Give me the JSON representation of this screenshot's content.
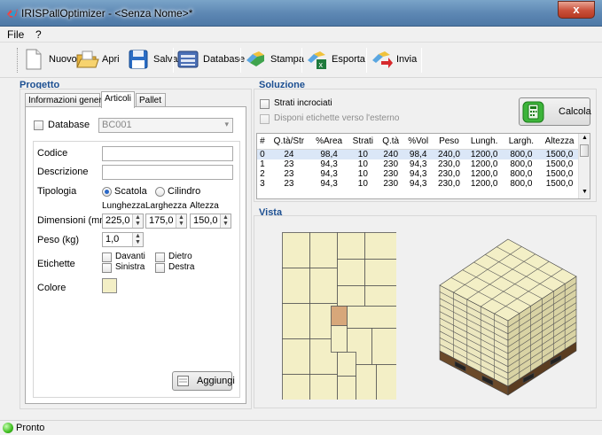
{
  "window": {
    "title": "IRISPallOptimizer - <Senza Nome>*",
    "close_label": "x"
  },
  "menu": {
    "file": "File",
    "help": "?"
  },
  "toolbar": {
    "nuovo": "Nuovo",
    "apri": "Apri",
    "salva": "Salva",
    "database": "Database",
    "stampa": "Stampa",
    "esporta": "Esporta",
    "invia": "Invia"
  },
  "progetto": {
    "title": "Progetto",
    "tabs": [
      "Informazioni generali",
      "Articoli",
      "Pallet"
    ],
    "database_label": "Database",
    "database_value": "BC001",
    "codice_label": "Codice",
    "codice_value": "",
    "descrizione_label": "Descrizione",
    "descrizione_value": "",
    "tipologia_label": "Tipologia",
    "tipologia_options": [
      "Scatola",
      "Cilindro"
    ],
    "tipologia_selected": "Scatola",
    "dim_headers": [
      "Lunghezza",
      "Larghezza",
      "Altezza"
    ],
    "dimensioni_label": "Dimensioni (mm)",
    "lunghezza": "225,0",
    "larghezza": "175,0",
    "altezza": "150,0",
    "peso_label": "Peso (kg)",
    "peso_value": "1,0",
    "etichette_label": "Etichette",
    "etichette": [
      "Davanti",
      "Dietro",
      "Sinistra",
      "Destra"
    ],
    "colore_label": "Colore",
    "colore_value": "#f3efc6",
    "aggiungi": "Aggiungi"
  },
  "soluzione": {
    "title": "Soluzione",
    "strati_incrociati": "Strati incrociati",
    "disponi_etichette": "Disponi etichette verso l'esterno",
    "calcola": "Calcola",
    "columns": [
      "#",
      "Q.tà/Str",
      "%Area",
      "Strati",
      "Q.tà",
      "%Vol",
      "Peso",
      "Lungh.",
      "Largh.",
      "Altezza"
    ],
    "rows": [
      [
        "0",
        "24",
        "98,4",
        "10",
        "240",
        "98,4",
        "240,0",
        "1200,0",
        "800,0",
        "1500,0"
      ],
      [
        "1",
        "23",
        "94,3",
        "10",
        "230",
        "94,3",
        "230,0",
        "1200,0",
        "800,0",
        "1500,0"
      ],
      [
        "2",
        "23",
        "94,3",
        "10",
        "230",
        "94,3",
        "230,0",
        "1200,0",
        "800,0",
        "1500,0"
      ],
      [
        "3",
        "23",
        "94,3",
        "10",
        "230",
        "94,3",
        "230,0",
        "1200,0",
        "800,0",
        "1500,0"
      ]
    ]
  },
  "vista": {
    "title": "Vista",
    "box_color": "#f3efc6",
    "highlight_color": "#d7a77a"
  },
  "status": {
    "text": "Pronto"
  }
}
